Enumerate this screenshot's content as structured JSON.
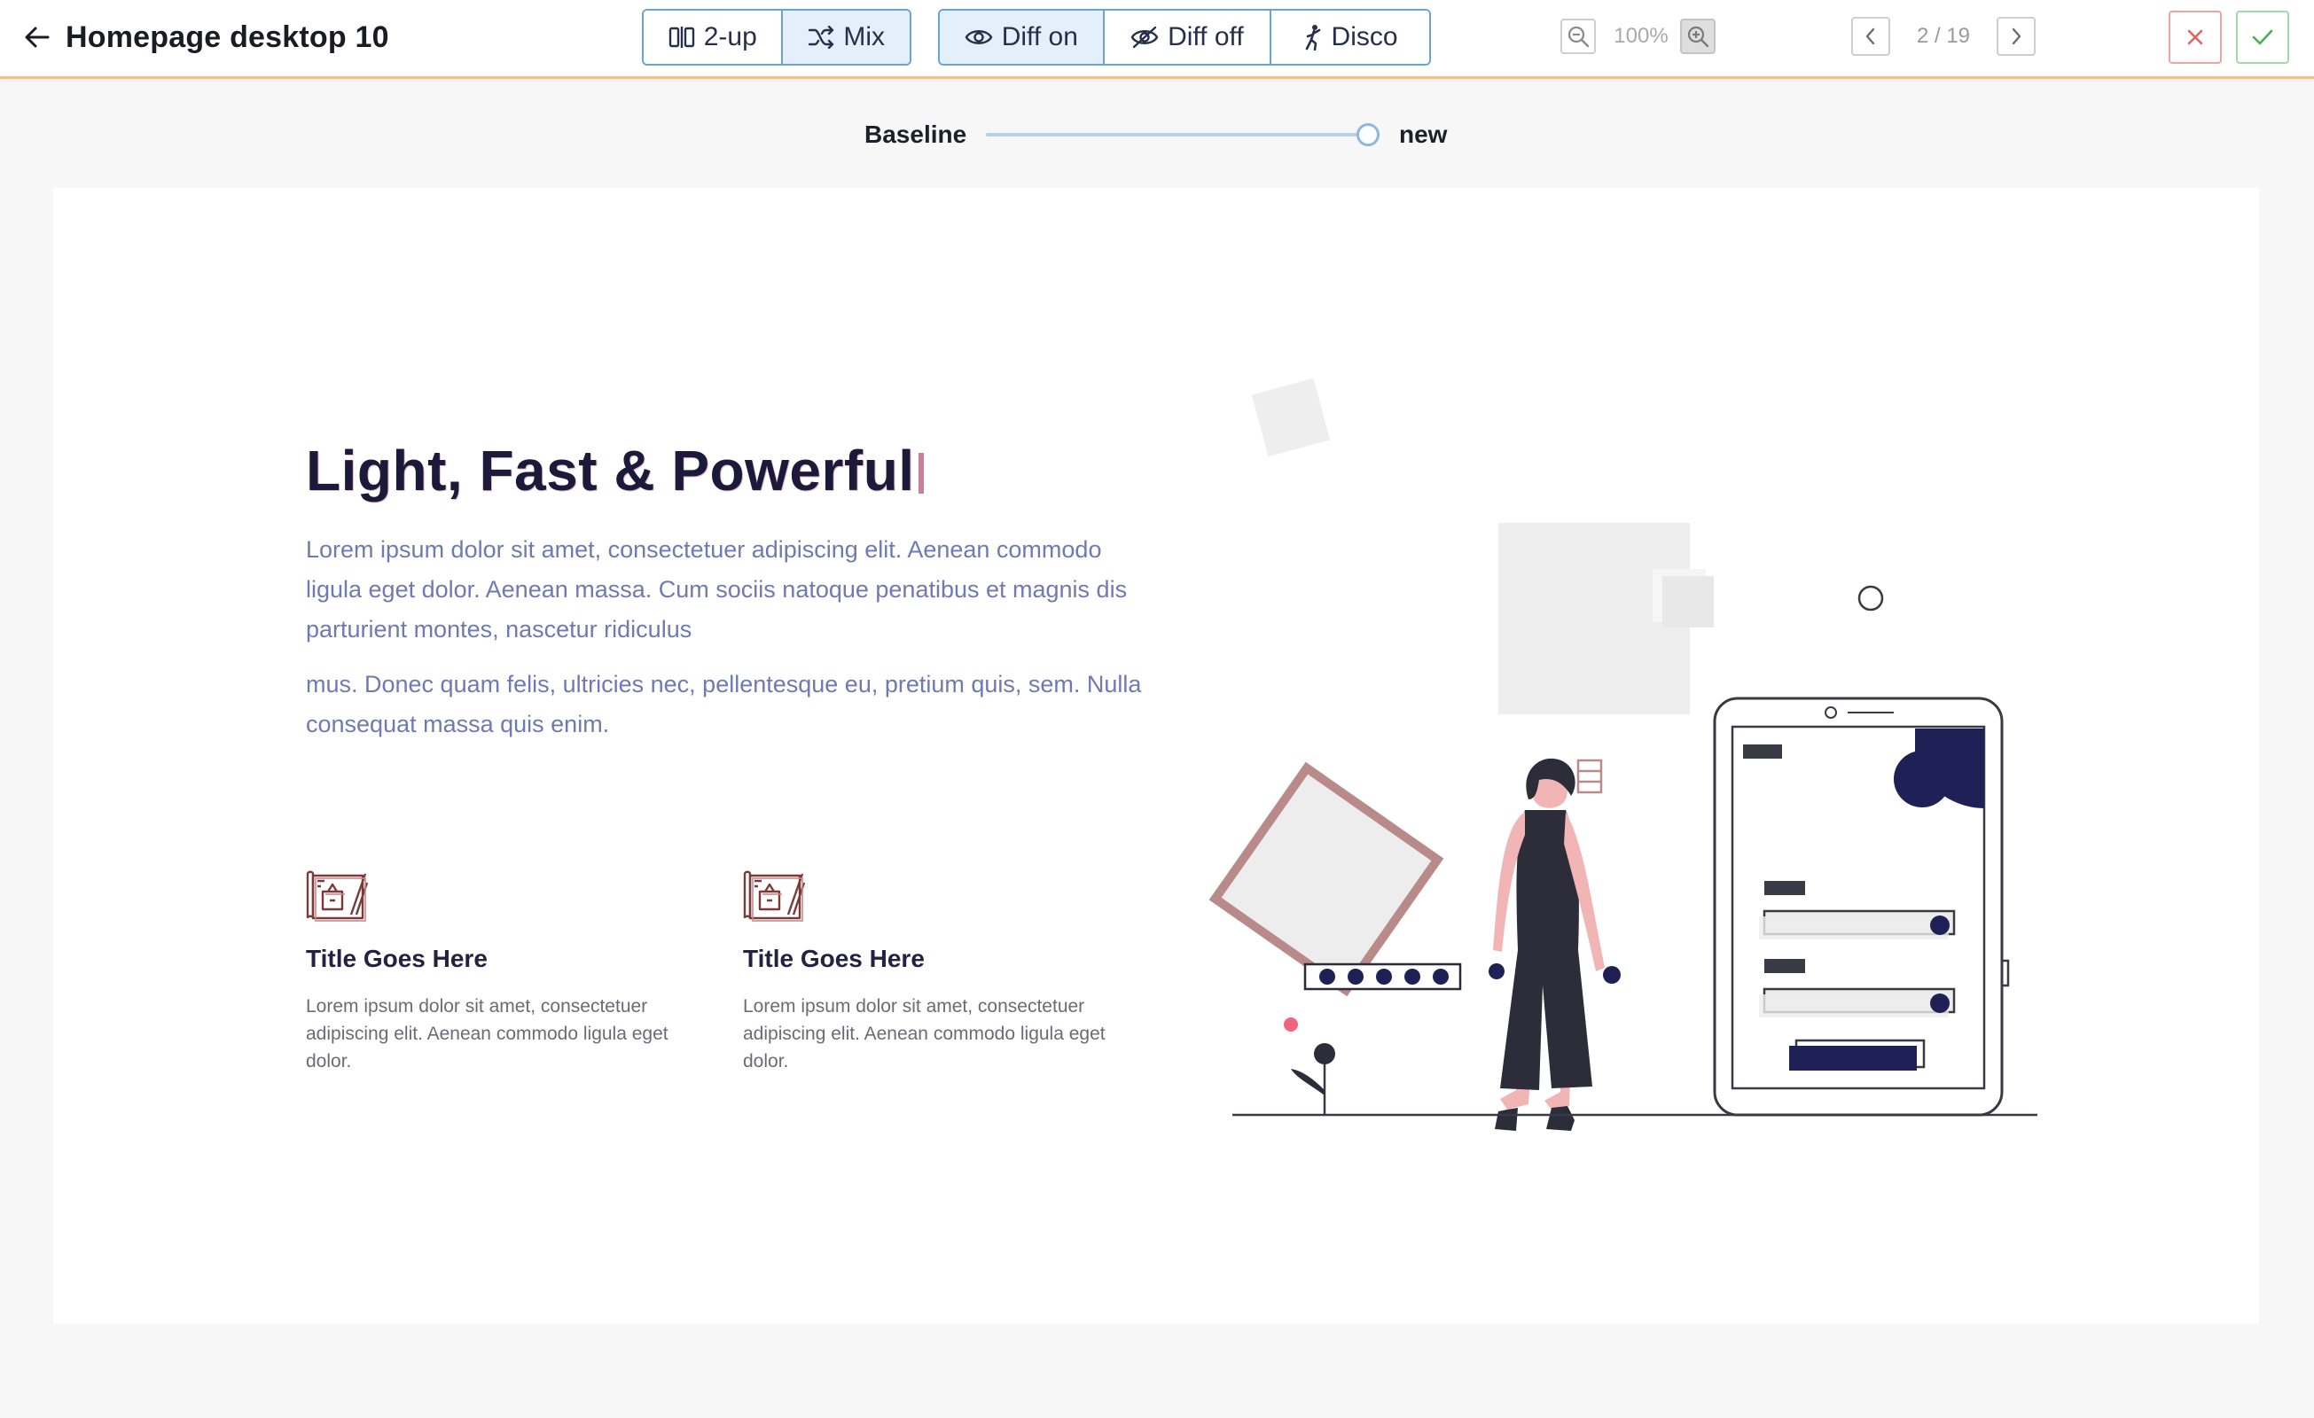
{
  "header": {
    "title": "Homepage desktop 10",
    "view_modes": [
      "2-up",
      "Mix"
    ],
    "diff_modes": [
      "Diff on",
      "Diff off",
      "Disco"
    ],
    "zoom_level": "100%",
    "page_counter": "2 / 19"
  },
  "slider": {
    "left_label": "Baseline",
    "right_label": "new",
    "position": 1.0
  },
  "preview": {
    "hero_title": "Light, Fast & Powerful",
    "paragraph_1": "Lorem ipsum dolor sit amet, consectetuer adipiscing elit. Aenean commodo ligula eget dolor. Aenean massa. Cum sociis natoque penatibus et magnis dis parturient montes, nascetur ridiculus",
    "paragraph_2": "mus. Donec quam felis, ultricies nec, pellentesque eu, pretium quis, sem. Nulla consequat massa quis enim.",
    "features": [
      {
        "title": "Title Goes Here",
        "text": "Lorem ipsum dolor sit amet, consectetuer adipiscing elit. Aenean commodo ligula eget dolor."
      },
      {
        "title": "Title Goes Here",
        "text": "Lorem ipsum dolor sit amet, consectetuer adipiscing elit. Aenean commodo ligula eget dolor."
      }
    ]
  },
  "icons": {
    "back": "arrow-left-icon",
    "two_up": "columns-icon",
    "mix": "shuffle-icon",
    "diff_on": "eye-icon",
    "diff_off": "eye-off-icon",
    "disco": "dancer-icon",
    "zoom_out": "zoom-out-icon",
    "zoom_in": "zoom-in-icon",
    "prev": "chevron-left-icon",
    "next": "chevron-right-icon",
    "reject": "close-icon",
    "approve": "check-icon",
    "feature": "blueprint-icon"
  },
  "colors": {
    "toolbar_accent": "#f3c27a",
    "segment_border": "#6aa3d6",
    "segment_active": "#e3effb",
    "reject": "#e06464",
    "approve": "#4caf50",
    "hero_text": "#1c1a3a",
    "body_text": "#6f79b4",
    "illustration_navy": "#1f2156",
    "illustration_rose": "#b98a8a"
  }
}
